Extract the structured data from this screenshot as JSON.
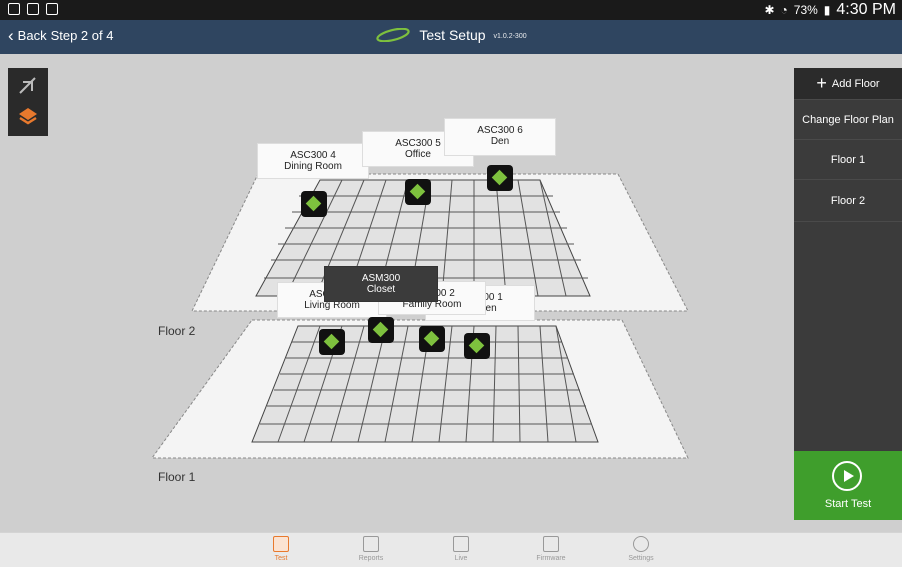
{
  "status_bar": {
    "battery": "73%",
    "time": "4:30 PM"
  },
  "app_bar": {
    "back_label": "Back",
    "step": "Step 2 of 4",
    "title": "Test Setup",
    "version": "v1.0.2-300"
  },
  "right_panel": {
    "add_floor": "Add Floor",
    "change_floor_plan": "Change Floor Plan",
    "floors": [
      "Floor 1",
      "Floor 2"
    ],
    "start_test": "Start Test"
  },
  "floor_labels": {
    "floor2": "Floor 2",
    "floor1": "Floor 1"
  },
  "sensors": [
    {
      "name": "ASC300 4",
      "room": "Dining Room"
    },
    {
      "name": "ASC300 5",
      "room": "Office"
    },
    {
      "name": "ASC300 6",
      "room": "Den"
    },
    {
      "name": "ASC300 3",
      "room": "Living Room"
    },
    {
      "name": "ASM300",
      "room": "Closet"
    },
    {
      "name": "ASC300 2",
      "room": "Family Room"
    },
    {
      "name": "ASC300 1",
      "room": "Kitchen"
    }
  ],
  "bottom_tabs": [
    "Test",
    "Reports",
    "Live",
    "Firmware",
    "Settings"
  ],
  "colors": {
    "accent": "#e8792d",
    "start": "#3f9e2c",
    "appbar": "#2f4560",
    "sensor_green": "#7ec13e"
  }
}
